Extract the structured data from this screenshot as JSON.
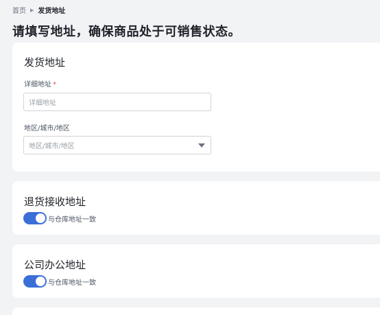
{
  "breadcrumb": {
    "home": "首页",
    "separator": "▶",
    "current": "发货地址"
  },
  "page_title": "请填写地址，确保商品处于可销售状态。",
  "shipping_card": {
    "title": "发货地址",
    "address_label": "详细地址",
    "required_mark": "*",
    "address_placeholder": "详细地址",
    "region_label": "地区/城市/地区",
    "region_value": "地区/城市/地区"
  },
  "return_card": {
    "title": "退货接收地址",
    "toggle_label": "与仓库地址一致",
    "toggle_on": true
  },
  "office_card": {
    "title": "公司办公地址",
    "toggle_label": "与仓库地址一致",
    "toggle_on": true
  },
  "colors": {
    "accent": "#3b6fd8",
    "required": "#e5484d",
    "background": "#f2f3f5"
  }
}
